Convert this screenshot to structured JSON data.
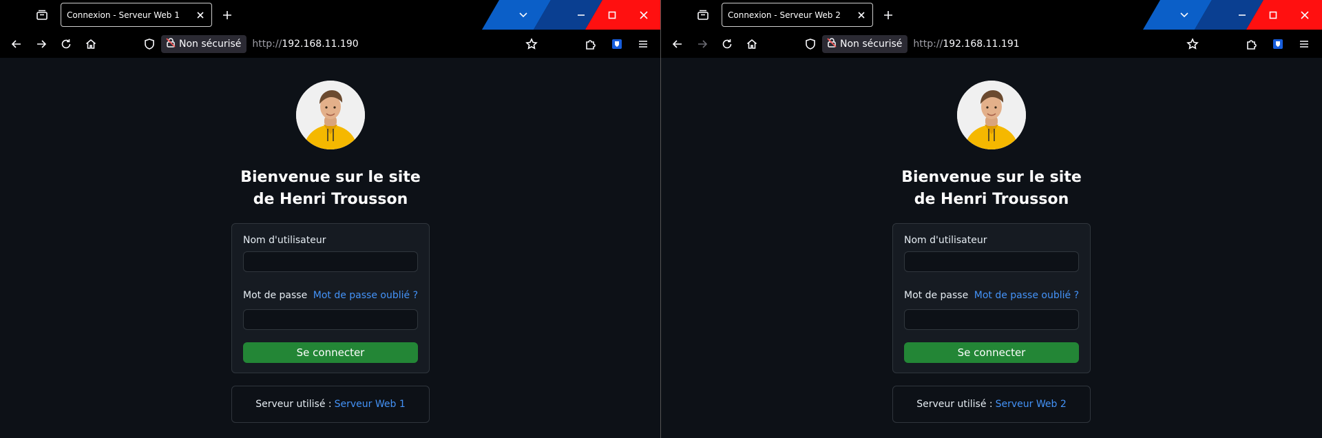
{
  "windows": [
    {
      "tab_title": "Connexion - Serveur Web 1",
      "not_secure_label": "Non sécurisé",
      "url_protocol": "http://",
      "url_host": "192.168.11.190",
      "forward_enabled": true,
      "heading_line1": "Bienvenue sur le site",
      "heading_line2": "de Henri Trousson",
      "username_label": "Nom d'utilisateur",
      "username_value": "",
      "password_label": "Mot de passe",
      "password_value": "",
      "forgot_label": "Mot de passe oublié ?",
      "submit_label": "Se connecter",
      "server_prefix": "Serveur utilisé :",
      "server_name": "Serveur Web 1"
    },
    {
      "tab_title": "Connexion - Serveur Web 2",
      "not_secure_label": "Non sécurisé",
      "url_protocol": "http://",
      "url_host": "192.168.11.191",
      "forward_enabled": false,
      "heading_line1": "Bienvenue sur le site",
      "heading_line2": "de Henri Trousson",
      "username_label": "Nom d'utilisateur",
      "username_value": "",
      "password_label": "Mot de passe",
      "password_value": "",
      "forgot_label": "Mot de passe oublié ?",
      "submit_label": "Se connecter",
      "server_prefix": "Serveur utilisé :",
      "server_name": "Serveur Web 2"
    }
  ],
  "icons": {
    "tab_list": "tab-list-icon",
    "close": "close-icon",
    "new_tab": "plus-icon",
    "back": "arrow-left-icon",
    "forward": "arrow-right-icon",
    "reload": "reload-icon",
    "home": "home-icon",
    "shield": "shield-icon",
    "lock": "broken-lock-icon",
    "bookmark": "star-icon",
    "extensions": "puzzle-icon",
    "bitwarden": "shield-extension-icon",
    "menu": "hamburger-icon",
    "chevron": "chevron-down-icon",
    "minimize": "minimize-icon",
    "maximize": "maximize-icon"
  },
  "colors": {
    "page_bg": "#0d1117",
    "card_bg": "#161b22",
    "border": "#30363d",
    "link": "#4493f8",
    "button_green": "#238636",
    "stripe_blue": "#0b5fc8",
    "stripe_dark_blue": "#0a3f91",
    "stripe_red": "#ff1010"
  }
}
